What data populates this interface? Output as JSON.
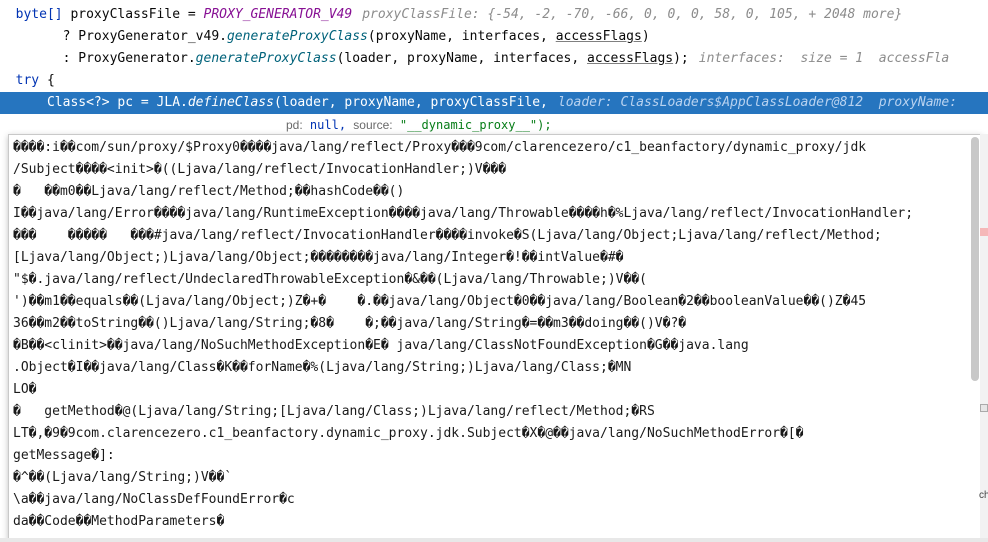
{
  "code": {
    "line1": {
      "type": "byte[] ",
      "var": "proxyClassFile",
      "assign": " = ",
      "const": "PROXY_GENERATOR_V49",
      "hint": "proxyClassFile: {-54, -2, -70, -66, 0, 0, 0, 58, 0, 105, + 2048 more}"
    },
    "line2": {
      "prefix": "        ? ProxyGenerator_v49.",
      "method": "generateProxyClass",
      "args_a": "(proxyName, interfaces, ",
      "args_u": "accessFlags",
      "args_b": ")"
    },
    "line3": {
      "prefix": "        : ProxyGenerator.",
      "method": "generateProxyClass",
      "args_a": "(loader, proxyName, interfaces, ",
      "args_u": "accessFlags",
      "args_b": ");",
      "hint": "interfaces:  size = 1  accessFla"
    },
    "line4": {
      "kw": "try",
      "rest": " {"
    },
    "line5": {
      "prefix": "    Class<?> pc = JLA.",
      "method": "defineClass",
      "args": "(loader, proxyName, proxyClassFile,",
      "hint": "loader: ClassLoaders$AppClassLoader@812  proxyName:"
    }
  },
  "hint_bar": {
    "pd_label": "pd:",
    "pd_value": "null,",
    "source_label": "source:",
    "source_value": "\"__dynamic_proxy__\");"
  },
  "popup": {
    "lines": [
      "����:i��com/sun/proxy/$Proxy0����java/lang/reflect/Proxy���9com/clarencezero/c1_beanfactory/dynamic_proxy/jdk",
      "/Subject����<init>�((Ljava/lang/reflect/InvocationHandler;)V���",
      "�   ��m0��Ljava/lang/reflect/Method;��hashCode��()",
      "I��java/lang/Error����java/lang/RuntimeException����java/lang/Throwable����h�%Ljava/lang/reflect/InvocationHandler;",
      "���    �����   ���#java/lang/reflect/InvocationHandler����invoke�S(Ljava/lang/Object;Ljava/lang/reflect/Method;",
      "[Ljava/lang/Object;)Ljava/lang/Object;��������java/lang/Integer�!��intValue�#�",
      "\"$�.java/lang/reflect/UndeclaredThrowableException�&��(Ljava/lang/Throwable;)V��(",
      "')��m1��equals��(Ljava/lang/Object;)Z�+�    �.��java/lang/Object�0��java/lang/Boolean�2��booleanValue��()Z�45",
      "36��m2��toString��()Ljava/lang/String;�8�    �;��java/lang/String�=��m3��doing��()V�?�",
      "�B��<clinit>��java/lang/NoSuchMethodException�E� java/lang/ClassNotFoundException�G��java.lang",
      ".Object�I��java/lang/Class�K��forName�%(Ljava/lang/String;)Ljava/lang/Class;�MN",
      "LO�",
      "�   getMethod�@(Ljava/lang/String;[Ljava/lang/Class;)Ljava/lang/reflect/Method;�RS",
      "LT�,�9�9com.clarencezero.c1_beanfactory.dynamic_proxy.jdk.Subject�X�@��java/lang/NoSuchMethodError�[�",
      "getMessage�]:",
      "�^��(Ljava/lang/String;)V��`",
      "\\a��java/lang/NoClassDefFoundError�c",
      "da��Code��MethodParameters�"
    ]
  },
  "edge": {
    "tag": "ch"
  },
  "colors": {
    "highlight": "#2675bf",
    "keyword": "#0033b3",
    "constant": "#871094",
    "method": "#00627a",
    "string": "#067d17",
    "hint": "#8c8c8c"
  }
}
